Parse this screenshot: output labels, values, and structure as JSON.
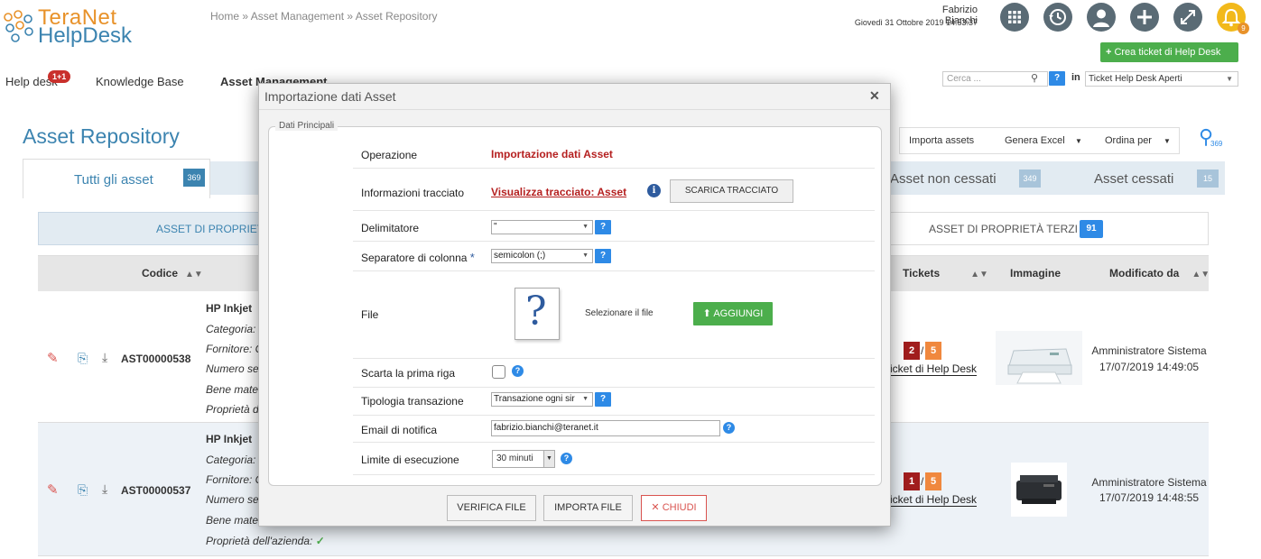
{
  "header": {
    "logo_line1": "TeraNet",
    "logo_line2": "HelpDesk",
    "breadcrumb": "Home » Asset Management » Asset Repository",
    "user_name": "Fabrizio Bianchi",
    "user_date": "Giovedì 31 Ottobre 2019 14:53:37",
    "bell_count": "9",
    "new_ticket_label": "Crea ticket di Help Desk"
  },
  "nav": {
    "items": [
      "Help desk",
      "Knowledge Base",
      "Asset Management"
    ],
    "helpdesk_badge": "1+1",
    "search_placeholder": "Cerca ...",
    "help_label": "?",
    "in_label": "in",
    "ticket_select": "Ticket Help Desk Aperti"
  },
  "page": {
    "title": "Asset Repository",
    "toolbar": [
      "Importa assets",
      "Genera Excel",
      "Ordina per"
    ],
    "search_count": "369",
    "tabs": [
      {
        "label": "Tutti gli asset",
        "count": "369"
      },
      {
        "label": "Asset non cessati",
        "count": "349"
      },
      {
        "label": "Asset cessati",
        "count": "15"
      }
    ],
    "subtabs": [
      {
        "label": "ASSET DI PROPRIETÀ"
      },
      {
        "label": "ASSET DI PROPRIETÀ TERZI",
        "count": "91"
      }
    ]
  },
  "table": {
    "columns": [
      "Codice",
      "Tickets",
      "Immagine",
      "Modificato da"
    ],
    "rows": [
      {
        "code": "AST00000538",
        "name": "HP Inkjet",
        "meta": [
          "Categoria:",
          "Fornitore: C",
          "Numero se",
          "Bene mate",
          "Proprietà d"
        ],
        "tickets_open": "2",
        "tickets_total": "5",
        "ticket_link": "icket di Help Desk",
        "modified_by": "Amministratore Sistema",
        "modified_at": "17/07/2019 14:49:05"
      },
      {
        "code": "AST00000537",
        "name": "HP Inkjet",
        "meta": [
          "Categoria:",
          "Fornitore: C",
          "Numero se",
          "Bene mate",
          "Proprietà dell'azienda:"
        ],
        "tickets_open": "1",
        "tickets_total": "5",
        "ticket_link": "icket di Help Desk",
        "modified_by": "Amministratore Sistema",
        "modified_at": "17/07/2019 14:48:55"
      }
    ]
  },
  "modal": {
    "title": "Importazione dati Asset",
    "legend": "Dati Principali",
    "fields": {
      "operation_label": "Operazione",
      "operation_value": "Importazione dati Asset",
      "trace_label": "Informazioni tracciato",
      "trace_link": "Visualizza tracciato: Asset",
      "trace_button": "SCARICA TRACCIATO",
      "delimiter_label": "Delimitatore",
      "delimiter_value": "\"",
      "separator_label": "Separatore di colonna",
      "separator_value": "semicolon (;)",
      "file_label": "File",
      "file_hint": "Selezionare il file",
      "add_button": "AGGIUNGI",
      "skip_first_label": "Scarta la prima riga",
      "transaction_label": "Tipologia transazione",
      "transaction_value": "Transazione ogni sir",
      "email_label": "Email di notifica",
      "email_value": "fabrizio.bianchi@teranet.it",
      "limit_label": "Limite di esecuzione",
      "limit_value": "30 minuti"
    },
    "buttons": {
      "verify": "VERIFICA FILE",
      "import": "IMPORTA FILE",
      "close": "CHIUDI"
    }
  }
}
